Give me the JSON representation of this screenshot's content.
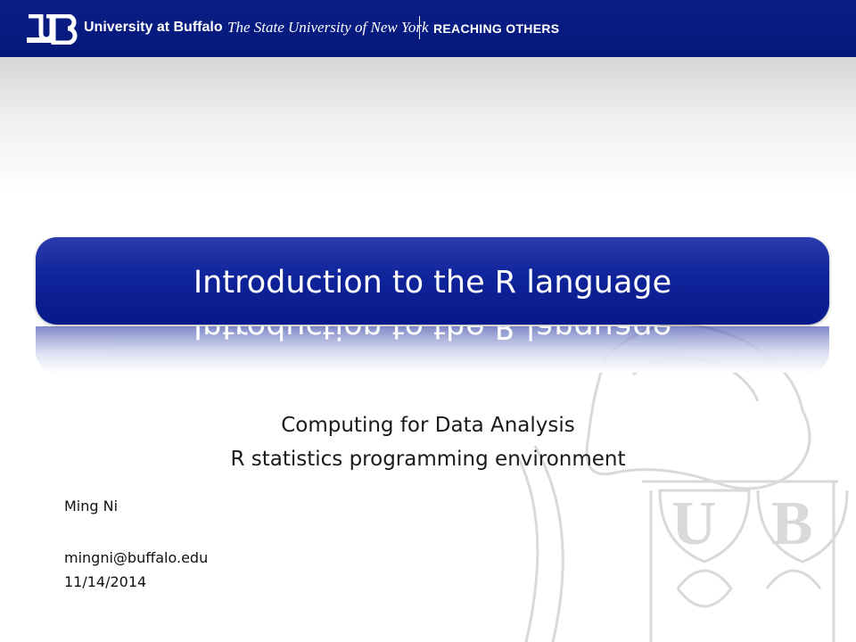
{
  "header": {
    "logo_text": "UB",
    "university": "University at Buffalo",
    "system": "The State University of New York",
    "tagline": "REACHING OTHERS"
  },
  "slide": {
    "title": "Introduction to the R language",
    "subtitle_line1": "Computing for Data Analysis",
    "subtitle_line2": "R statistics programming environment",
    "author": "Ming Ni",
    "email": "mingni@buffalo.edu",
    "date": "11/14/2014"
  },
  "seal": {
    "letters": [
      "U",
      "B"
    ]
  }
}
